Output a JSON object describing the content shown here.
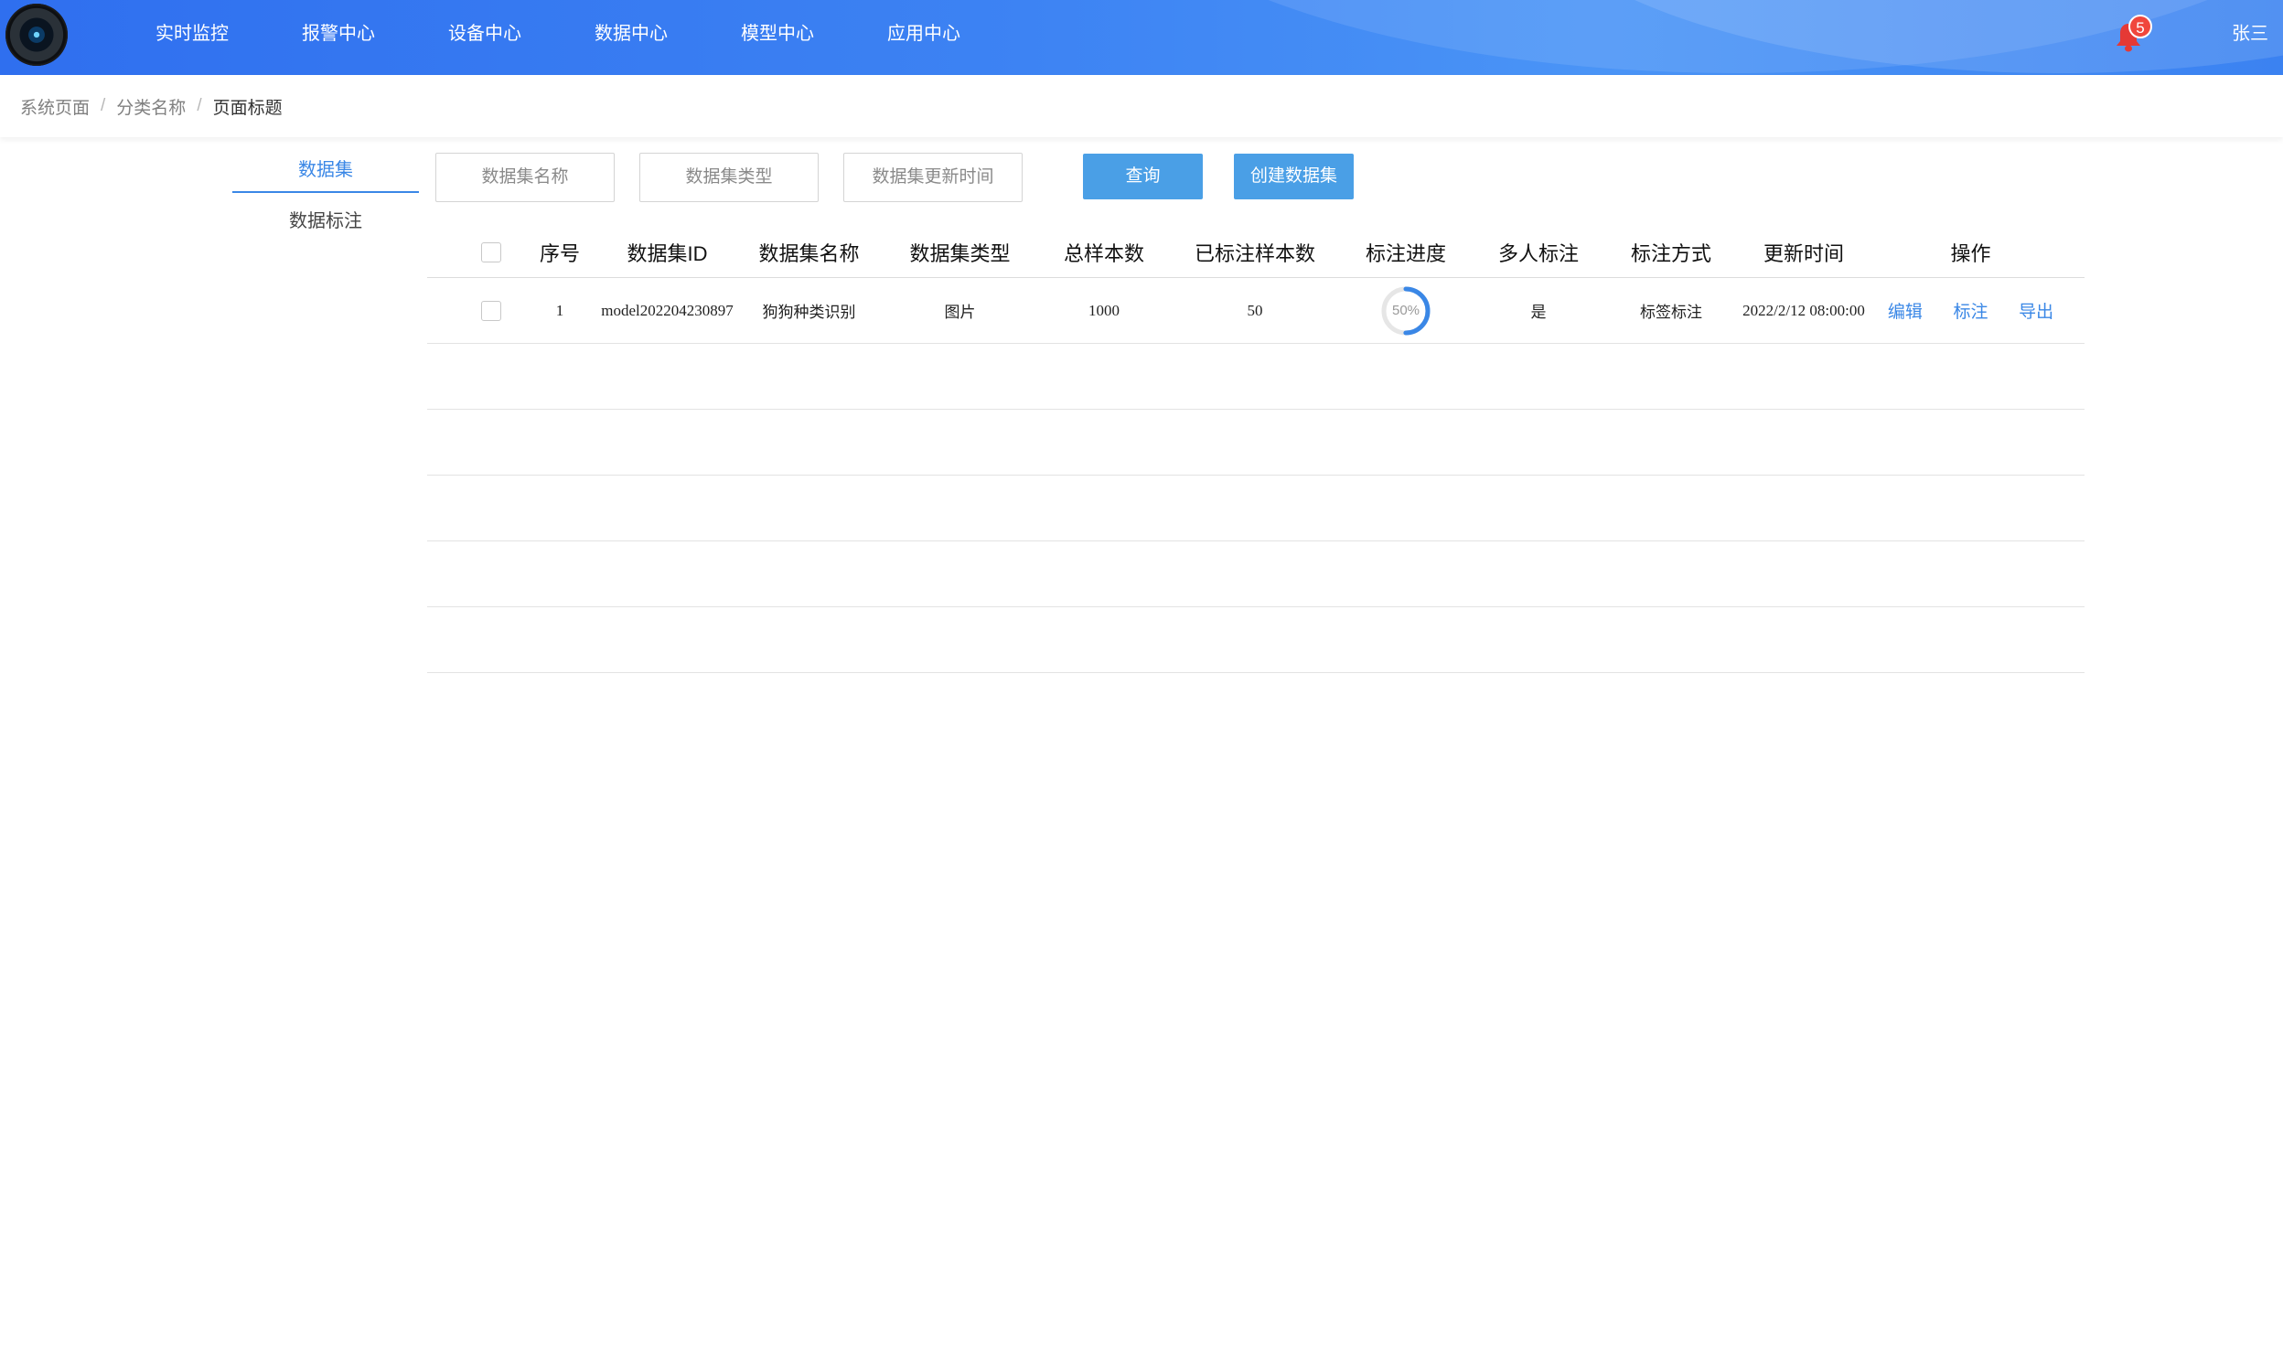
{
  "nav": {
    "logo_icon": "camera-lens-icon",
    "items": [
      "实时监控",
      "报警中心",
      "设备中心",
      "数据中心",
      "模型中心",
      "应用中心"
    ],
    "notification_count": "5",
    "bell_icon": "bell-icon",
    "user_name": "张三"
  },
  "breadcrumb": [
    "系统页面",
    "分类名称",
    "页面标题"
  ],
  "side_tabs": {
    "items": [
      "数据集",
      "数据标注"
    ],
    "active_index": 0
  },
  "filters": {
    "name_placeholder": "数据集名称",
    "type_placeholder": "数据集类型",
    "time_placeholder": "数据集更新时间",
    "query_button": "查询",
    "create_button": "创建数据集"
  },
  "table": {
    "columns": [
      "序号",
      "数据集ID",
      "数据集名称",
      "数据集类型",
      "总样本数",
      "已标注样本数",
      "标注进度",
      "多人标注",
      "标注方式",
      "更新时间",
      "操作"
    ],
    "rows": [
      {
        "index": "1",
        "id": "model202204230897",
        "name": "狗狗种类识别",
        "type": "图片",
        "total": "1000",
        "labeled": "50",
        "progress": 50,
        "progress_label": "50%",
        "multi": "是",
        "method": "标签标注",
        "updated": "2022/2/12 08:00:00",
        "actions": [
          "编辑",
          "标注",
          "导出"
        ]
      }
    ]
  },
  "colors": {
    "accent": "#3a87e6",
    "button": "#4a9fe6",
    "badge": "#f0463c",
    "bell": "#e53935",
    "progress_track": "#e6e6e6"
  }
}
